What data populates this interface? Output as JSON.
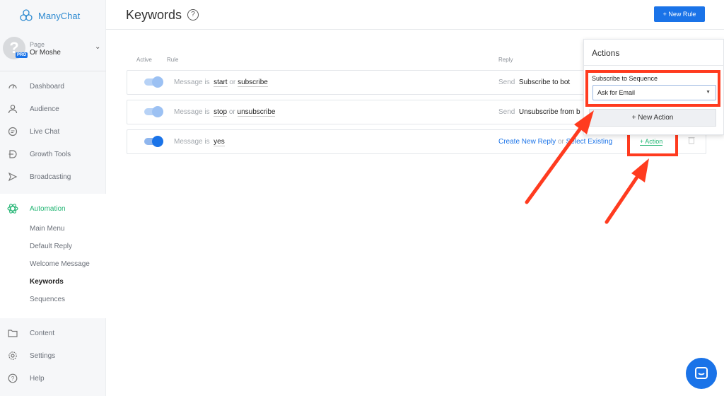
{
  "app": {
    "name": "ManyChat"
  },
  "profile": {
    "page_label": "Page",
    "page_name": "Or Moshe",
    "badge": "PRO",
    "avatar_glyph": "?"
  },
  "nav": {
    "dashboard": "Dashboard",
    "audience": "Audience",
    "live_chat": "Live Chat",
    "growth_tools": "Growth Tools",
    "broadcasting": "Broadcasting",
    "automation": "Automation",
    "automation_items": [
      "Main Menu",
      "Default Reply",
      "Welcome Message",
      "Keywords",
      "Sequences"
    ],
    "content": "Content",
    "settings": "Settings",
    "help": "Help"
  },
  "header": {
    "title": "Keywords",
    "help_icon": "?",
    "new_rule": "+ New Rule"
  },
  "table": {
    "col_active": "Active",
    "col_rule": "Rule",
    "col_reply": "Reply",
    "rows": [
      {
        "active": false,
        "prefix": "Message is",
        "kw1": "start",
        "or": "or",
        "kw2": "subscribe",
        "reply_prefix": "Send",
        "reply_value": "Subscribe to bot"
      },
      {
        "active": false,
        "prefix": "Message is",
        "kw1": "stop",
        "or": "or",
        "kw2": "unsubscribe",
        "reply_prefix": "Send",
        "reply_value": "Unsubscribe from b"
      },
      {
        "active": true,
        "prefix": "Message is",
        "kw1": "yes",
        "create_reply": "Create New Reply",
        "or": "or",
        "select_existing": "Select Existing",
        "action": "+ Action"
      }
    ]
  },
  "actions_panel": {
    "title": "Actions",
    "sequence_label": "Subscribe to Sequence",
    "sequence_value": "Ask for Email",
    "new_action": "+ New Action"
  },
  "colors": {
    "accent": "#1a73e8",
    "green": "#22b573",
    "highlight": "#ff3b1f"
  }
}
